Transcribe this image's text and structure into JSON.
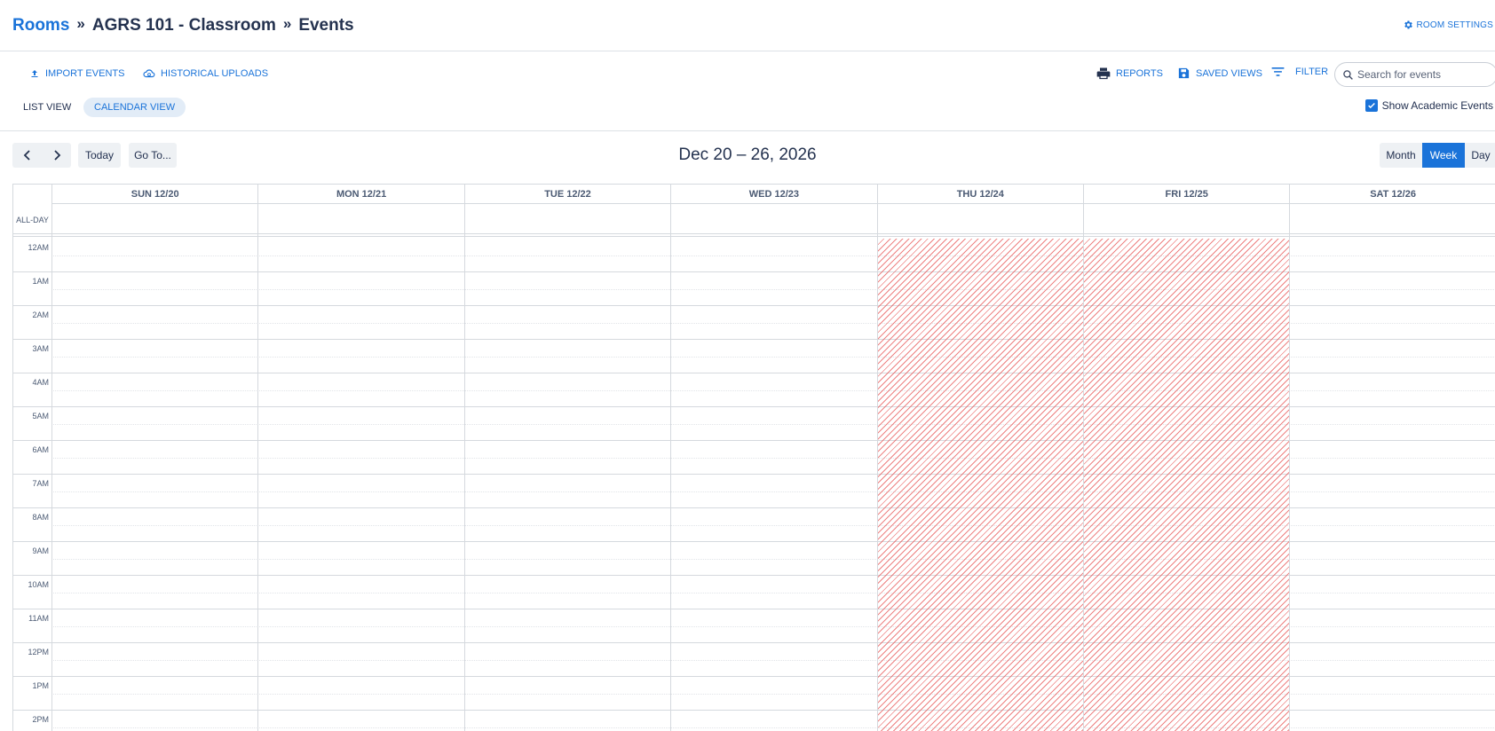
{
  "breadcrumb": {
    "rooms": "Rooms",
    "room": "AGRS 101 - Classroom",
    "page": "Events",
    "separator": "»"
  },
  "header": {
    "room_settings": "ROOM SETTINGS"
  },
  "toolbar": {
    "import_events": "IMPORT EVENTS",
    "historical_uploads": "HISTORICAL UPLOADS",
    "reports": "REPORTS",
    "saved_views": "SAVED VIEWS",
    "filter": "FILTER",
    "search_placeholder": "Search for events",
    "list_view": "LIST VIEW",
    "calendar_view": "CALENDAR VIEW",
    "show_academic_events": "Show Academic Events",
    "show_academic_checked": true
  },
  "calendar": {
    "today": "Today",
    "goto": "Go To...",
    "range": "Dec 20 – 26, 2026",
    "modes": {
      "month": "Month",
      "week": "Week",
      "day": "Day"
    },
    "active_mode": "Week",
    "allday": "ALL-DAY",
    "days": [
      "SUN 12/20",
      "MON 12/21",
      "TUE 12/22",
      "WED 12/23",
      "THU 12/24",
      "FRI 12/25",
      "SAT 12/26"
    ],
    "blocked_days": [
      "THU 12/24",
      "FRI 12/25"
    ],
    "hours": [
      "12AM",
      "1AM",
      "2AM",
      "3AM",
      "4AM",
      "5AM",
      "6AM",
      "7AM",
      "8AM",
      "9AM",
      "10AM",
      "11AM",
      "12PM",
      "1PM",
      "2PM"
    ]
  },
  "colors": {
    "accent": "#1a73d9",
    "text": "#1f2d4d",
    "holiday_stripe": "#e85858",
    "grid_line": "#d5d9de",
    "button_bg": "#eef1f4"
  }
}
